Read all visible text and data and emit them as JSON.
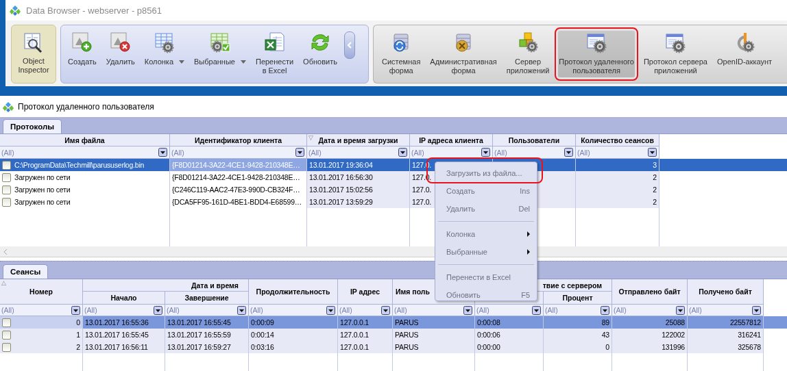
{
  "window": {
    "title": "Data Browser - webserver - p8561"
  },
  "toolbar": {
    "groups": [
      {
        "kind": "inspector",
        "items": [
          {
            "label": "Object\nInspector",
            "kind": "magnifier",
            "on": true
          }
        ]
      },
      {
        "kind": "actions",
        "items": [
          {
            "label": "Создать",
            "kind": "create",
            "dropdown": false
          },
          {
            "label": "Удалить",
            "kind": "delete",
            "dropdown": false
          },
          {
            "label": "Колонка",
            "kind": "column",
            "dropdown": true
          },
          {
            "label": "Выбранные",
            "kind": "favorites",
            "dropdown": true
          },
          {
            "label": "Перенести\nв Excel",
            "kind": "excel",
            "dropdown": false
          },
          {
            "label": "Обновить",
            "kind": "refresh",
            "dropdown": false
          }
        ]
      },
      {
        "kind": "forms",
        "items": [
          {
            "label": "Системная\nформа",
            "kind": "server-sync",
            "selected": false,
            "highlighted": false
          },
          {
            "label": "Административная\nформа",
            "kind": "server-tools",
            "selected": false,
            "highlighted": false
          },
          {
            "label": "Сервер\nприложений",
            "kind": "blocks",
            "selected": false,
            "highlighted": false
          },
          {
            "label": "Протокол удаленного\nпользователя",
            "kind": "window-gear",
            "selected": true,
            "highlighted": true
          },
          {
            "label": "Протокол сервера\nприложений",
            "kind": "window-gear",
            "selected": false,
            "highlighted": false
          },
          {
            "label": "OpenID-аккаунт",
            "kind": "openid",
            "selected": false,
            "highlighted": false
          }
        ]
      }
    ]
  },
  "caption": "Протокол удаленного пользователя",
  "protocols": {
    "tabs": [
      {
        "label": "Протоколы",
        "selected": true
      }
    ],
    "focused": true,
    "columns": [
      {
        "label": "Имя файла"
      },
      {
        "label": "Идентификатор клиента"
      },
      {
        "label": "Дата и время загрузки",
        "sort": "▽"
      },
      {
        "label": "IP адреса клиента"
      },
      {
        "label": "Пользователи"
      },
      {
        "label": "Количество сеансов"
      }
    ],
    "filters": [
      "(All)",
      "(All)",
      "(All)",
      "(All)",
      "(All)",
      "(All)"
    ],
    "rows": [
      {
        "selected": true,
        "checked": false,
        "cells": [
          "C:\\ProgramData\\Techmill\\parususerlog.bin",
          "{F8D01214-3A22-4CE1-9428-210348E…",
          "13.01.2017 19:36:04",
          "127.0.",
          null,
          "3"
        ]
      },
      {
        "selected": false,
        "checked": false,
        "cells": [
          "Загружен по сети",
          "{F8D01214-3A22-4CE1-9428-210348E…",
          "13.01.2017 16:56:30",
          "127.0.",
          null,
          "2"
        ]
      },
      {
        "selected": false,
        "checked": false,
        "cells": [
          "Загружен по сети",
          "{C246C119-AAC2-47E3-990D-CB324F…",
          "13.01.2017 15:02:56",
          "127.0.",
          null,
          "2"
        ]
      },
      {
        "selected": false,
        "checked": false,
        "cells": [
          "Загружен по сети",
          "{DCA5FF95-161D-4BE1-BDD4-E68599…",
          "13.01.2017 13:59:29",
          "127.0.",
          null,
          "2"
        ]
      }
    ]
  },
  "sessions": {
    "tabs": [
      {
        "label": "Сеансы",
        "selected": true
      }
    ],
    "focused": false,
    "column_groups": [
      {
        "label": "Дата и время"
      },
      {
        "label": "твие с сервером"
      }
    ],
    "columns": [
      {
        "label": "Номер",
        "sort": "△"
      },
      {
        "label": "Начало"
      },
      {
        "label": "Завершение"
      },
      {
        "label": "Продолжительность"
      },
      {
        "label": "IP адрес"
      },
      {
        "label": "Имя поль"
      },
      null,
      {
        "label": "Процент"
      },
      {
        "label": "Отправлено байт"
      },
      {
        "label": "Получено байт"
      }
    ],
    "filters": [
      "(All)",
      "(All)",
      "(All)",
      "(All)",
      "(All)",
      "(All)",
      "(All)",
      "(All)",
      "(All)",
      "(All)"
    ],
    "rows": [
      {
        "selected": true,
        "checked": false,
        "cells": [
          "0",
          "13.01.2017 16:55:36",
          "13.01.2017 16:55:45",
          "0:00:09",
          "127.0.0.1",
          "PARUS",
          "0:00:08",
          "89",
          "25088",
          "22557812"
        ]
      },
      {
        "selected": false,
        "checked": false,
        "cells": [
          "1",
          "13.01.2017 16:55:45",
          "13.01.2017 16:55:59",
          "0:00:14",
          "127.0.0.1",
          "PARUS",
          "0:00:06",
          "43",
          "122002",
          "316241"
        ]
      },
      {
        "selected": false,
        "checked": false,
        "cells": [
          "2",
          "13.01.2017 16:56:11",
          "13.01.2017 16:59:27",
          "0:03:16",
          "127.0.0.1",
          "PARUS",
          "0:00:00",
          "0",
          "131996",
          "325678"
        ]
      }
    ]
  },
  "context_menu": {
    "items": [
      {
        "kind": "item",
        "label": "Загрузить из файла...",
        "highlighted": true
      },
      {
        "kind": "item",
        "label": "Создать",
        "shortcut": "Ins",
        "highlighted": false
      },
      {
        "kind": "item",
        "label": "Удалить",
        "shortcut": "Del",
        "highlighted": false
      },
      {
        "kind": "separator"
      },
      {
        "kind": "submenu",
        "label": "Колонка",
        "highlighted": false
      },
      {
        "kind": "submenu",
        "label": "Выбранные",
        "highlighted": false
      },
      {
        "kind": "separator"
      },
      {
        "kind": "item",
        "label": "Перенести в Excel",
        "highlighted": false
      },
      {
        "kind": "item",
        "label": "Обновить",
        "shortcut": "F5",
        "highlighted": false
      }
    ]
  }
}
